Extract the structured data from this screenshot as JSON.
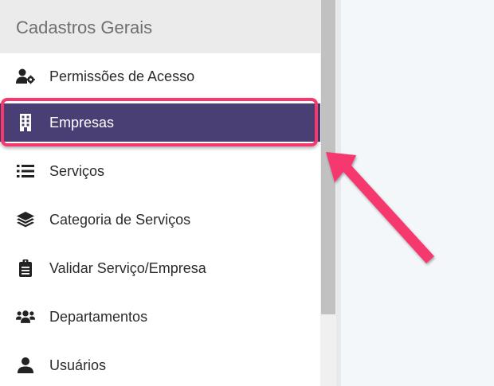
{
  "sidebar": {
    "section_title": "Cadastros Gerais",
    "active_color": "#4a3f75",
    "items": [
      {
        "label": "Permissões de Acesso",
        "icon": "user-gear-icon"
      },
      {
        "label": "Empresas",
        "icon": "building-icon",
        "active": true
      },
      {
        "label": "Serviços",
        "icon": "list-icon"
      },
      {
        "label": "Categoria de Serviços",
        "icon": "layers-icon"
      },
      {
        "label": "Validar Serviço/Empresa",
        "icon": "clipboard-icon"
      },
      {
        "label": "Departamentos",
        "icon": "users-icon"
      },
      {
        "label": "Usuários",
        "icon": "user-icon"
      }
    ]
  },
  "annotation": {
    "highlight_color": "#f5386e"
  }
}
